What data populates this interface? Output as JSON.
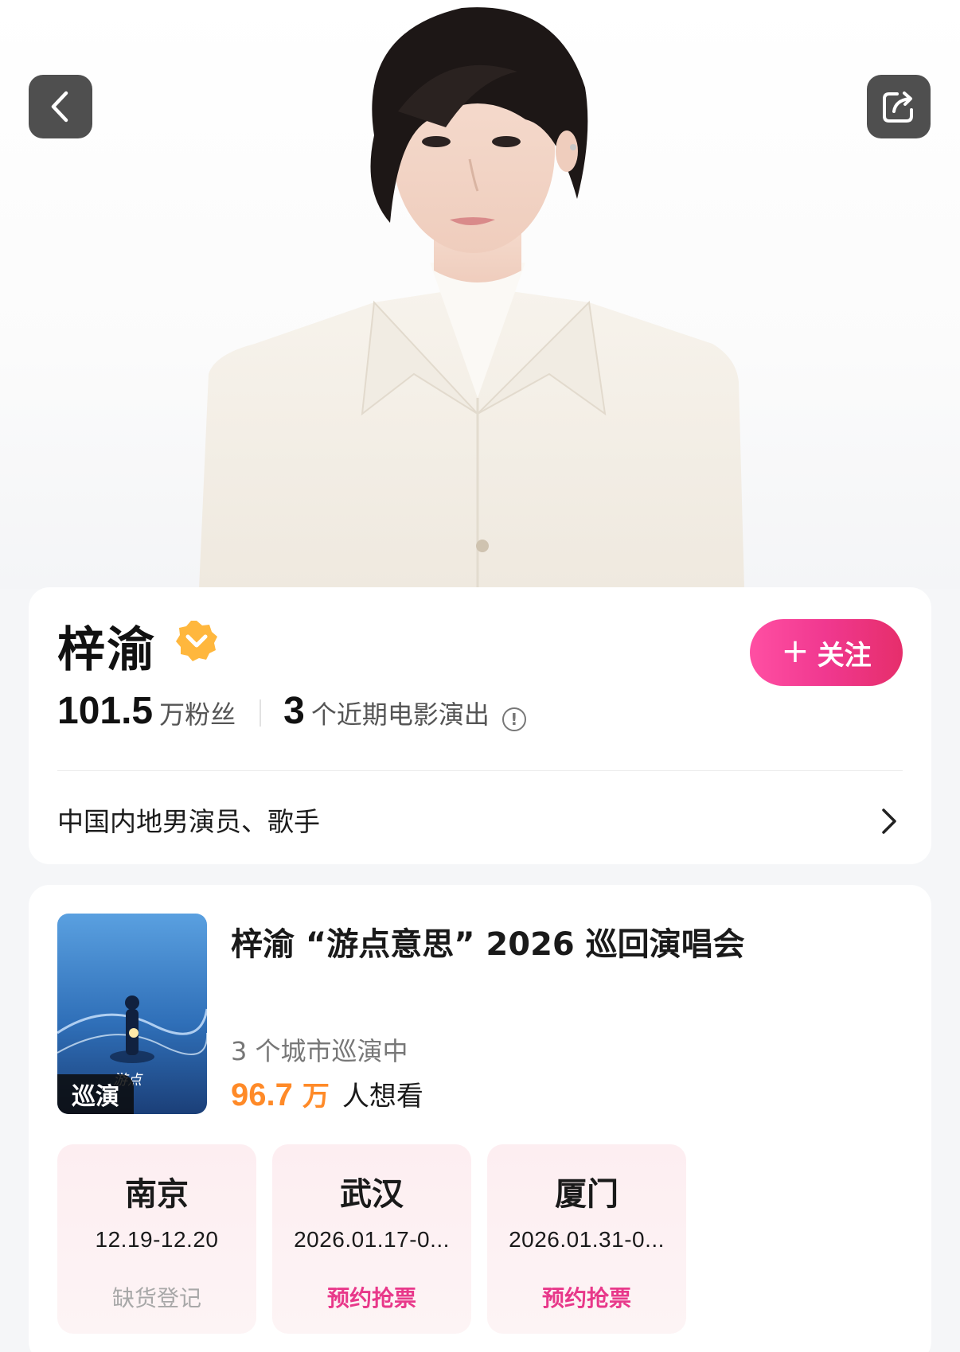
{
  "artist": {
    "name": "梓渝",
    "fans_num": "101.5",
    "fans_unit": "万粉丝",
    "shows_num": "3",
    "shows_label": "个近期电影演出",
    "description": "中国内地男演员、歌手"
  },
  "header": {
    "back_icon": "chevron-left-icon",
    "share_icon": "share-icon"
  },
  "follow_button": {
    "plus": "+",
    "label": "关注"
  },
  "colors": {
    "accent_pink": "#e8388a",
    "want_orange": "#ff8a28",
    "verified_orange": "#ffb73d"
  },
  "tour": {
    "badge": "巡演",
    "title": "梓渝 “游点意思” 2026 巡回演唱会",
    "cities_text": "3 个城市巡演中",
    "want_num": "96.7",
    "want_unit": "万",
    "want_text": "人想看",
    "cities": [
      {
        "name": "南京",
        "date": "12.19-12.20",
        "status": "缺货登记"
      },
      {
        "name": "武汉",
        "date": "2026.01.17-0...",
        "status": "预约抢票"
      },
      {
        "name": "厦门",
        "date": "2026.01.31-0...",
        "status": "预约抢票"
      }
    ]
  }
}
